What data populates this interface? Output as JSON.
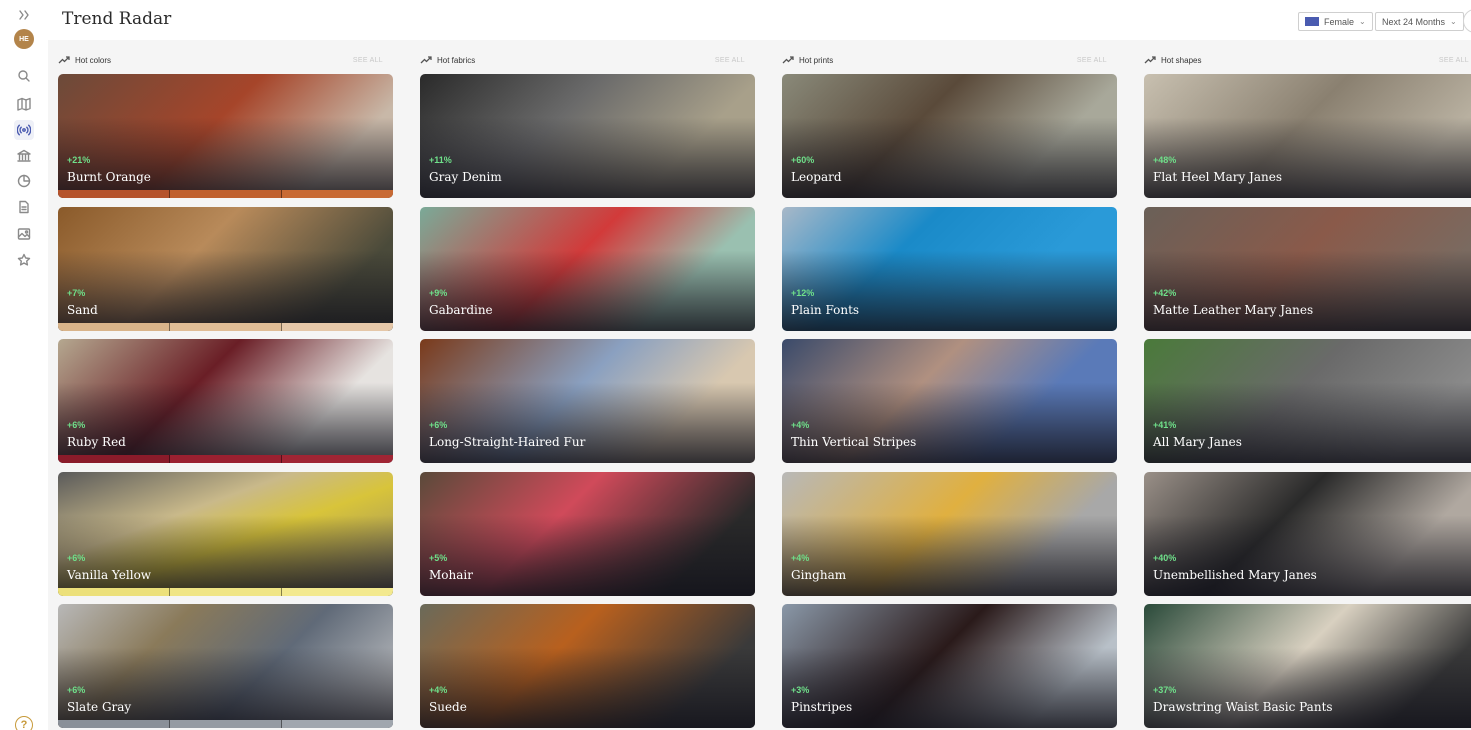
{
  "header": {
    "title": "Trend Radar",
    "gender_filter": "Female",
    "period_filter": "Next 24 Months"
  },
  "sidebar": {
    "logo_text": "HE",
    "items": [
      {
        "icon": "collapse-icon"
      },
      {
        "icon": "search-icon"
      },
      {
        "icon": "map-icon"
      },
      {
        "icon": "radar-icon",
        "active": true
      },
      {
        "icon": "museum-icon"
      },
      {
        "icon": "pie-chart-icon"
      },
      {
        "icon": "document-icon"
      },
      {
        "icon": "image-icon"
      },
      {
        "icon": "star-icon"
      }
    ],
    "help_label": "?"
  },
  "columns": [
    {
      "title": "Hot colors",
      "see_all": "SEE ALL",
      "cards": [
        {
          "pct": "+21%",
          "name": "Burnt Orange",
          "bg": "linear-gradient(135deg,#6b4a3a,#a6452a 45%,#c8b8a8 80%)",
          "swatch": [
            "#b5532c",
            "#c0602e",
            "#c86a34"
          ]
        },
        {
          "pct": "+7%",
          "name": "Sand",
          "bg": "linear-gradient(135deg,#8a5a2a,#b88a5a 40%,#4a4a3a 80%)",
          "swatch": [
            "#d9b48a",
            "#e0bd96",
            "#e5c7a8"
          ]
        },
        {
          "pct": "+6%",
          "name": "Ruby Red",
          "bg": "linear-gradient(135deg,#b5a890,#6a1e26 40%,#e6e3e0 75%)",
          "swatch": [
            "#8a1b2a",
            "#9a2030",
            "#a02534"
          ]
        },
        {
          "pct": "+6%",
          "name": "Vanilla Yellow",
          "bg": "linear-gradient(160deg,#5a5a5a,#c9b98a 35%,#d8c43a 55%,#8a8070)",
          "swatch": [
            "#ece07a",
            "#f0e585",
            "#f3e98f"
          ]
        },
        {
          "pct": "+6%",
          "name": "Slate Gray",
          "bg": "linear-gradient(135deg,#b8b8b8,#8a7a5a 30%,#606a78 60%,#d0d0d0)",
          "swatch": [
            "#8a9098",
            "#959ba3",
            "#a0a6ae"
          ]
        }
      ]
    },
    {
      "title": "Hot fabrics",
      "see_all": "SEE ALL",
      "cards": [
        {
          "pct": "+11%",
          "name": "Gray Denim",
          "bg": "linear-gradient(135deg,#2a2a2a,#6a6a6a 40%,#a8a08a 75%)"
        },
        {
          "pct": "+9%",
          "name": "Gabardine",
          "bg": "linear-gradient(135deg,#7aaa98,#d23a3a 45%,#9ac0b0 75%)"
        },
        {
          "pct": "+6%",
          "name": "Long-Straight-Haired Fur",
          "bg": "linear-gradient(135deg,#7a3a1a,#8aa0c0 45%,#d8c8b0 75%)"
        },
        {
          "pct": "+5%",
          "name": "Mohair",
          "bg": "linear-gradient(135deg,#5a4a3a,#d04a5a 40%,#2a2a2a 80%)"
        },
        {
          "pct": "+4%",
          "name": "Suede",
          "bg": "linear-gradient(135deg,#6a6a5a,#b8601e 40%,#3a3a3a 80%)"
        }
      ]
    },
    {
      "title": "Hot prints",
      "see_all": "SEE ALL",
      "cards": [
        {
          "pct": "+60%",
          "name": "Leopard",
          "bg": "linear-gradient(135deg,#8a8a7a,#5a4a3a 40%,#a8a89a 75%)"
        },
        {
          "pct": "+12%",
          "name": "Plain Fonts",
          "bg": "linear-gradient(135deg,#a8b8c8,#1a8ac8 35%,#2a9ad8 70%)"
        },
        {
          "pct": "+4%",
          "name": "Thin Vertical Stripes",
          "bg": "linear-gradient(135deg,#3a4a6a,#b09080 40%,#5a7ab8 70%)"
        },
        {
          "pct": "+4%",
          "name": "Gingham",
          "bg": "linear-gradient(135deg,#b8b8b8,#e0b040 45%,#a8a8a8 75%)"
        },
        {
          "pct": "+3%",
          "name": "Pinstripes",
          "bg": "linear-gradient(135deg,#8a98a8,#2a1a1a 45%,#b8c0c8 80%)"
        }
      ]
    },
    {
      "title": "Hot shapes",
      "see_all": "SEE ALL",
      "cards": [
        {
          "pct": "+48%",
          "name": "Flat Heel Mary Janes",
          "bg": "linear-gradient(135deg,#c8c0b0,#8a8070 45%,#b8b0a0 80%)"
        },
        {
          "pct": "+42%",
          "name": "Matte Leather Mary Janes",
          "bg": "linear-gradient(135deg,#6a6058,#8a5a4a 45%,#7a6a60 80%)"
        },
        {
          "pct": "+41%",
          "name": "All Mary Janes",
          "bg": "linear-gradient(135deg,#4a7a3a,#6a6a6a 45%,#8a8a8a 80%)"
        },
        {
          "pct": "+40%",
          "name": "Unembellished Mary Janes",
          "bg": "linear-gradient(135deg,#9a9088,#2a2a2a 40%,#b0a8a0 75%)"
        },
        {
          "pct": "+37%",
          "name": "Drawstring Waist Basic Pants",
          "bg": "linear-gradient(135deg,#2a4a3a,#d8d0c0 45%,#3a3a3a 80%)"
        }
      ]
    }
  ]
}
